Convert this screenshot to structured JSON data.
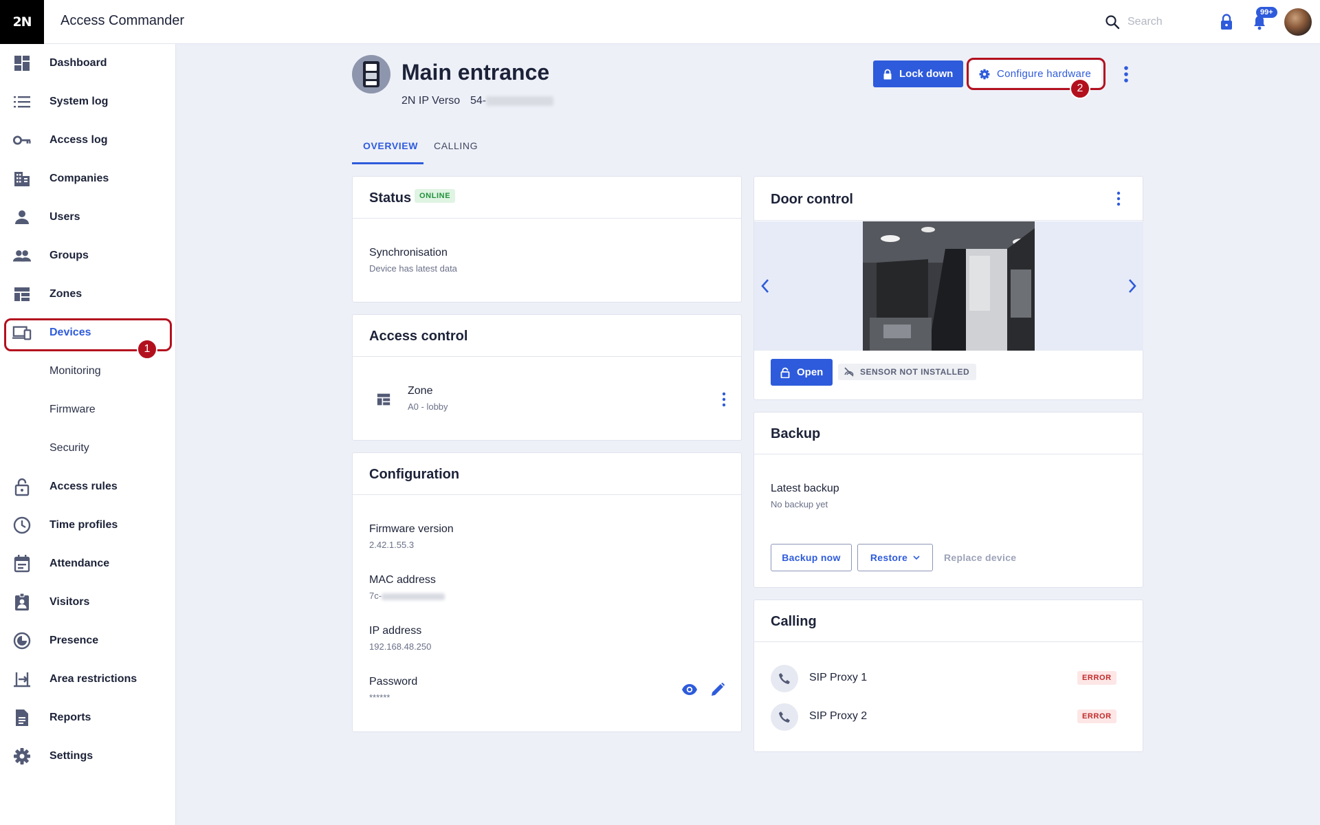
{
  "app": {
    "logo": "2N",
    "title": "Access Commander"
  },
  "topbar": {
    "search_placeholder": "Search",
    "notifications_badge": "99+"
  },
  "sidebar": {
    "items": [
      {
        "label": "Dashboard",
        "icon": "dashboard-icon"
      },
      {
        "label": "System log",
        "icon": "list-icon"
      },
      {
        "label": "Access log",
        "icon": "key-icon"
      },
      {
        "label": "Companies",
        "icon": "building-icon"
      },
      {
        "label": "Users",
        "icon": "person-icon"
      },
      {
        "label": "Groups",
        "icon": "people-icon"
      },
      {
        "label": "Zones",
        "icon": "zones-icon"
      },
      {
        "label": "Devices",
        "icon": "devices-icon",
        "active": true
      },
      {
        "label": "Monitoring",
        "sub": true
      },
      {
        "label": "Firmware",
        "sub": true
      },
      {
        "label": "Security",
        "sub": true
      },
      {
        "label": "Access rules",
        "icon": "lock-open-icon"
      },
      {
        "label": "Time profiles",
        "icon": "clock-icon"
      },
      {
        "label": "Attendance",
        "icon": "calendar-icon"
      },
      {
        "label": "Visitors",
        "icon": "badge-icon"
      },
      {
        "label": "Presence",
        "icon": "presence-icon"
      },
      {
        "label": "Area restrictions",
        "icon": "area-icon"
      },
      {
        "label": "Reports",
        "icon": "report-icon"
      },
      {
        "label": "Settings",
        "icon": "gear-icon"
      }
    ]
  },
  "annotations": {
    "step1": "1",
    "step2": "2"
  },
  "device": {
    "name": "Main entrance",
    "model": "2N IP Verso",
    "serial_prefix": "54-",
    "lockdown_label": "Lock down",
    "configure_label": "Configure hardware"
  },
  "tabs": [
    {
      "label": "OVERVIEW",
      "active": true
    },
    {
      "label": "CALLING"
    }
  ],
  "status_card": {
    "title": "Status",
    "badge": "ONLINE",
    "sync_label": "Synchronisation",
    "sync_value": "Device has latest data"
  },
  "access_control": {
    "title": "Access control",
    "zone_label": "Zone",
    "zone_value": "A0 - lobby"
  },
  "configuration": {
    "title": "Configuration",
    "firmware_label": "Firmware version",
    "firmware_value": "2.42.1.55.3",
    "mac_label": "MAC address",
    "mac_prefix": "7c-",
    "ip_label": "IP address",
    "ip_value": "192.168.48.250",
    "password_label": "Password",
    "password_value": "******"
  },
  "door_control": {
    "title": "Door control",
    "open_label": "Open",
    "sensor_label": "SENSOR NOT INSTALLED"
  },
  "backup": {
    "title": "Backup",
    "latest_label": "Latest backup",
    "latest_value": "No backup yet",
    "backup_now": "Backup now",
    "restore": "Restore",
    "replace_device": "Replace device"
  },
  "calling": {
    "title": "Calling",
    "proxies": [
      {
        "name": "SIP Proxy 1",
        "status": "ERROR"
      },
      {
        "name": "SIP Proxy 2",
        "status": "ERROR"
      }
    ]
  },
  "colors": {
    "primary": "#2e5bdb",
    "highlight": "#b3101e",
    "online": "#20913a",
    "error": "#c02a2a"
  }
}
